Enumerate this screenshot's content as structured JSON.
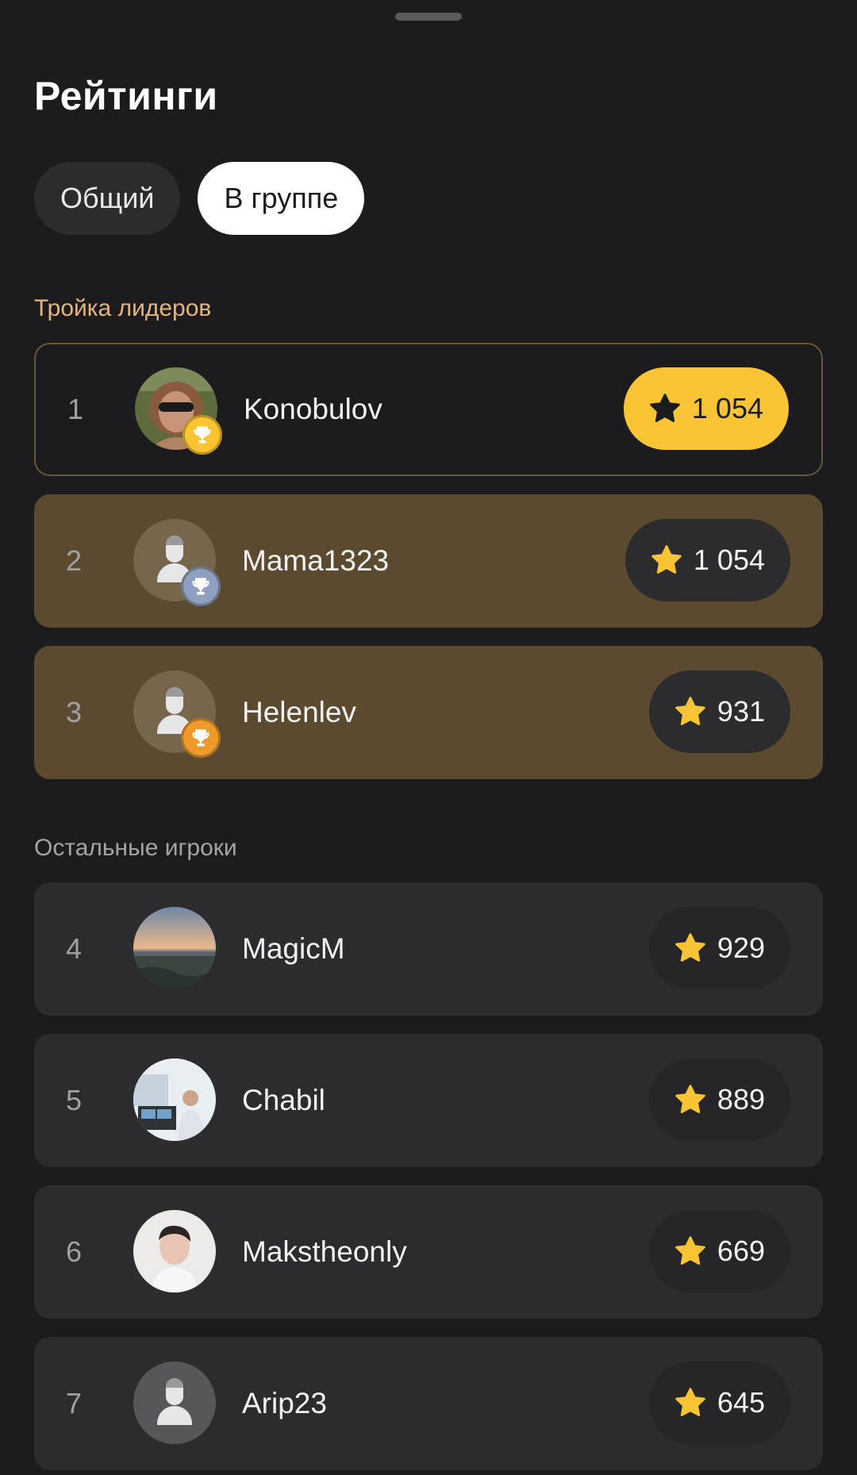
{
  "page": {
    "title": "Рейтинги",
    "tabs": [
      {
        "label": "Общий",
        "active": false
      },
      {
        "label": "В группе",
        "active": true
      }
    ],
    "sections": {
      "top_title": "Тройка лидеров",
      "rest_title": "Остальные игроки"
    }
  },
  "leaders": [
    {
      "rank": "1",
      "name": "Konobulov",
      "score": "1 054",
      "avatar": "photo",
      "badge": "gold-trophy-icon"
    },
    {
      "rank": "2",
      "name": "Mama1323",
      "score": "1 054",
      "avatar": "default",
      "badge": "silver-trophy-icon"
    },
    {
      "rank": "3",
      "name": "Helenlev",
      "score": "931",
      "avatar": "default",
      "badge": "bronze-trophy-icon"
    }
  ],
  "others": [
    {
      "rank": "4",
      "name": "MagicM",
      "score": "929",
      "avatar": "photo"
    },
    {
      "rank": "5",
      "name": "Chabil",
      "score": "889",
      "avatar": "photo"
    },
    {
      "rank": "6",
      "name": "Makstheonly",
      "score": "669",
      "avatar": "photo"
    },
    {
      "rank": "7",
      "name": "Arip23",
      "score": "645",
      "avatar": "default"
    }
  ],
  "colors": {
    "background": "#1c1c1e",
    "card": "#2c2c2e",
    "leader_card": "#5b4a2e",
    "accent_gold": "#fac535",
    "section_top": "#e5b57b",
    "badge_silver": "#8f9fbf",
    "badge_bronze": "#ed9a2d"
  }
}
